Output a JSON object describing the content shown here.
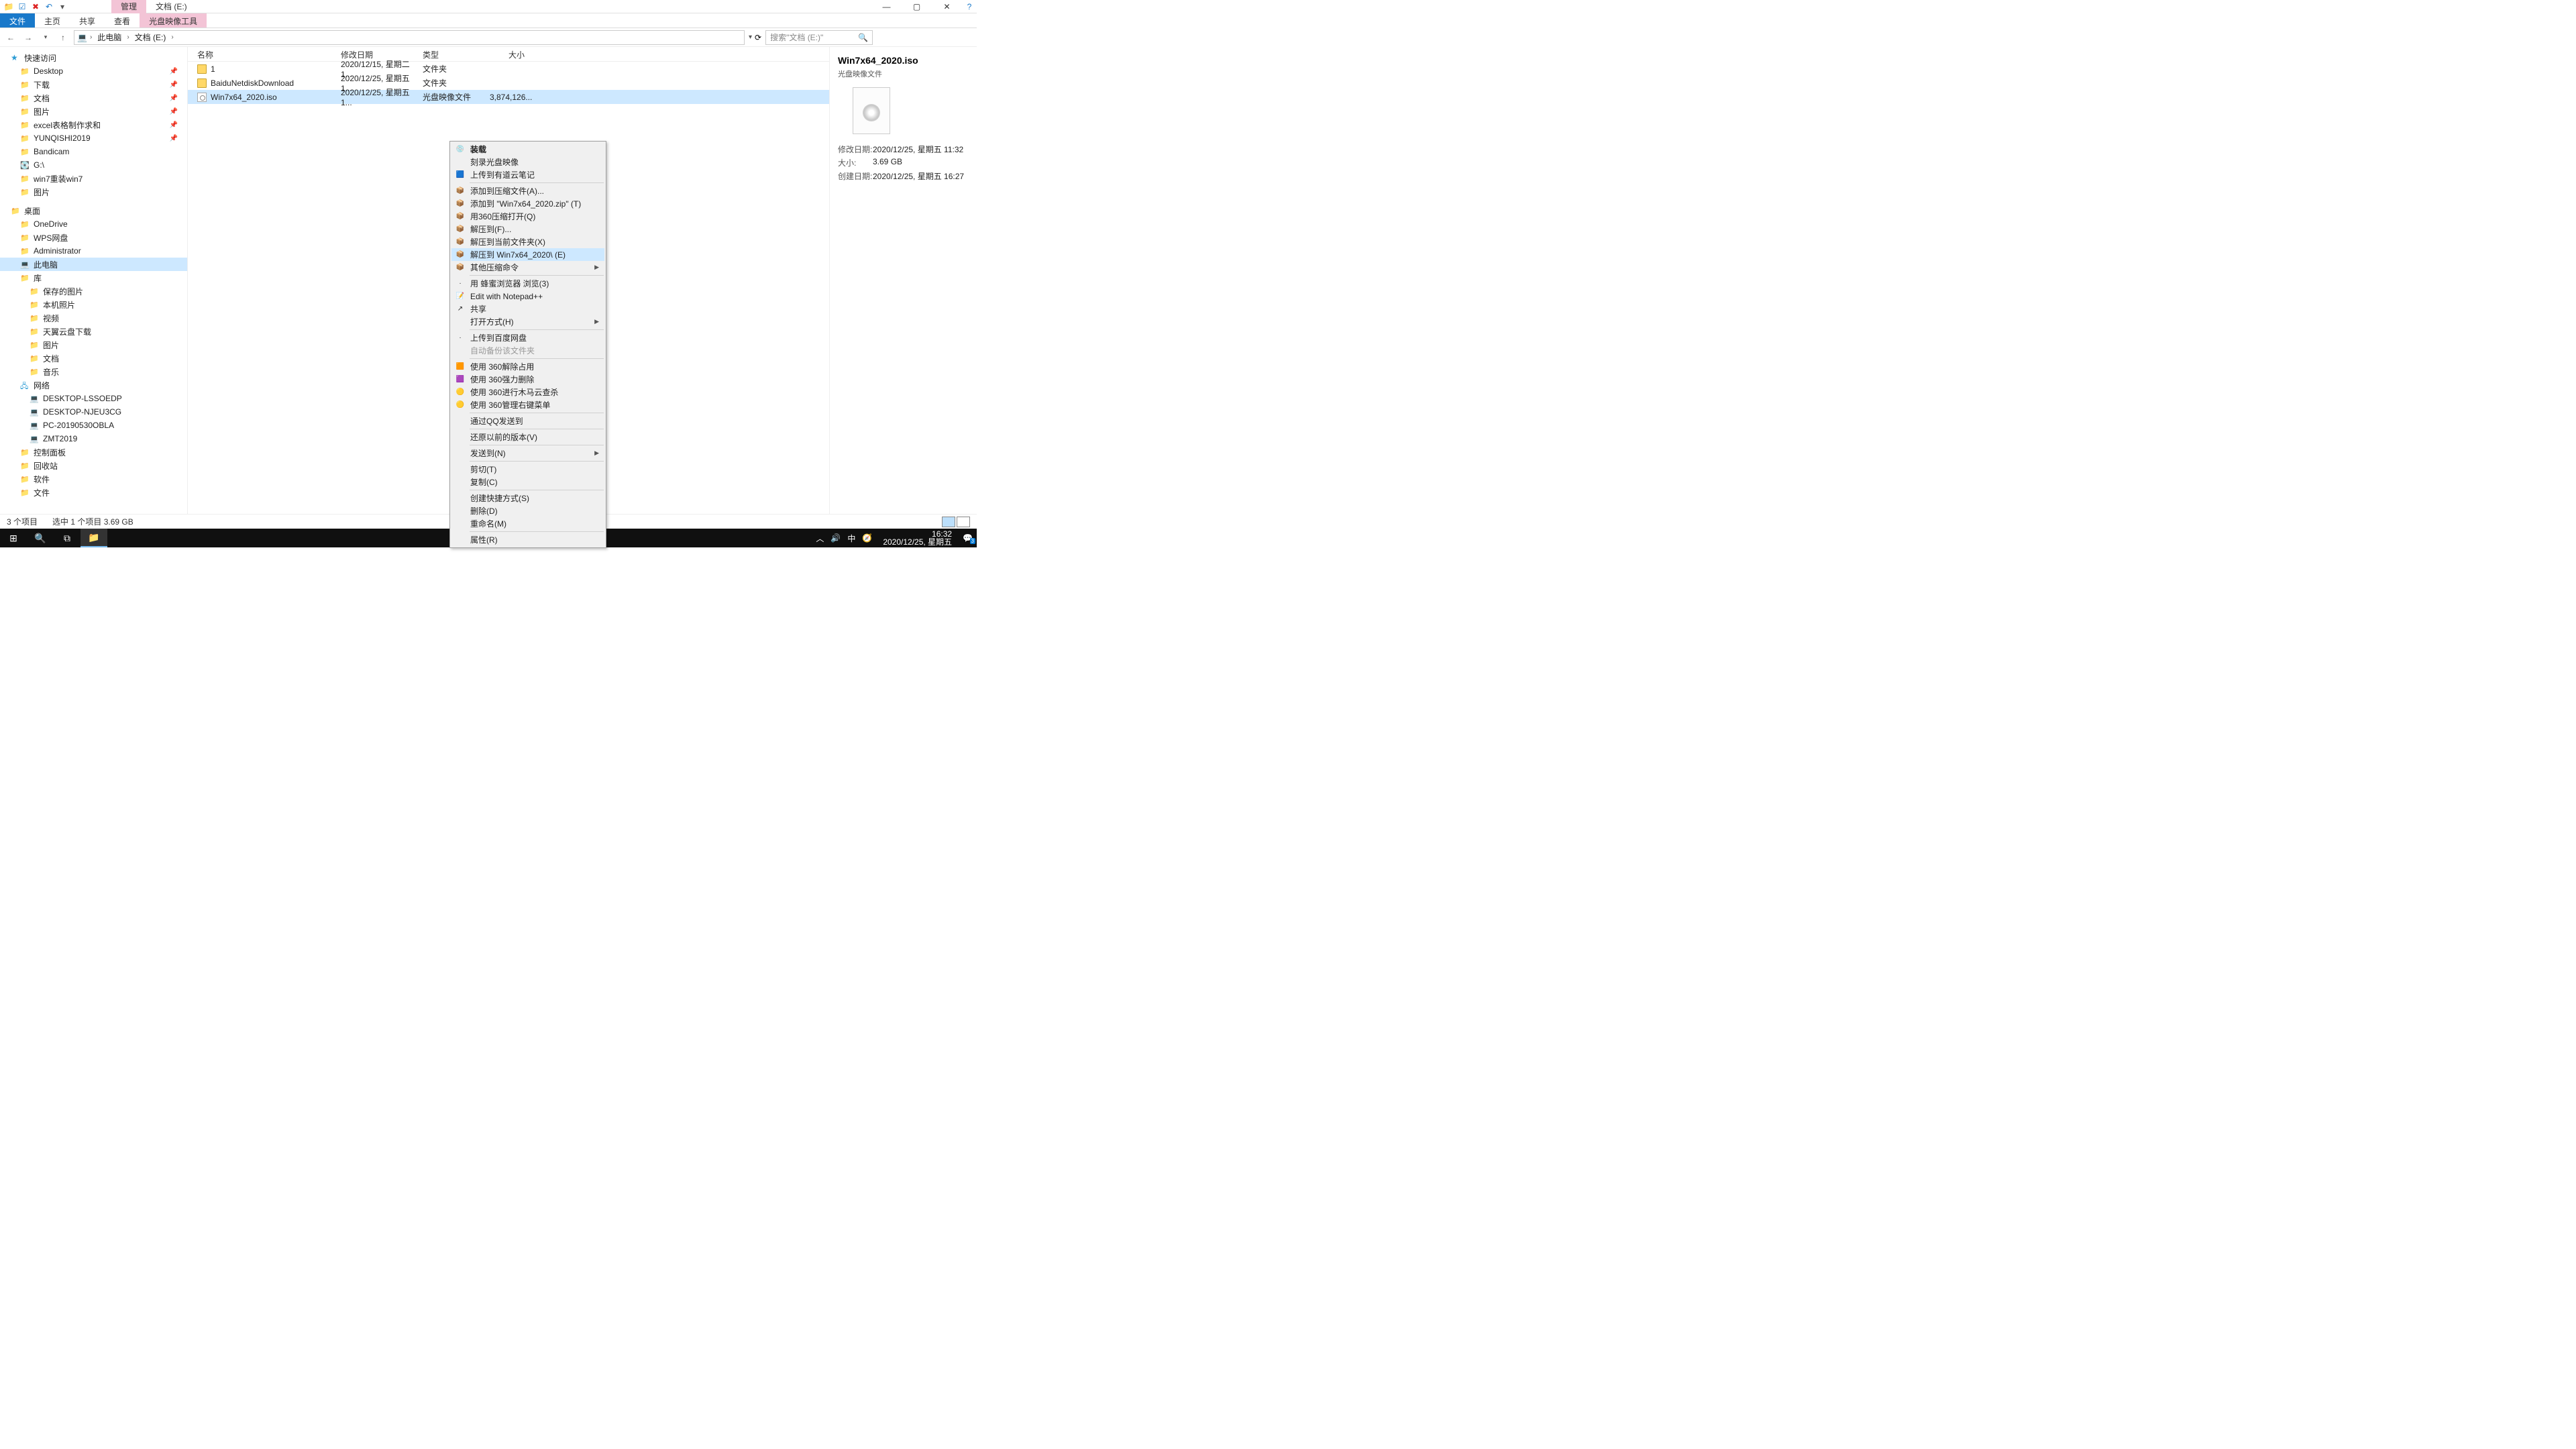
{
  "titlebar": {
    "tab_active": "管理",
    "tab_title": "文档 (E:)"
  },
  "ribbon": {
    "file": "文件",
    "home": "主页",
    "share": "共享",
    "view": "查看",
    "disc": "光盘映像工具"
  },
  "address": {
    "back": "←",
    "fwd": "→",
    "up": "↑",
    "crumbs": [
      "此电脑",
      "文档 (E:)"
    ],
    "refresh": "⟳",
    "search_placeholder": "搜索\"文档 (E:)\""
  },
  "tree": [
    {
      "label": "快速访问",
      "depth": 0,
      "icon": "star"
    },
    {
      "label": "Desktop",
      "depth": 1,
      "icon": "folder",
      "pin": true
    },
    {
      "label": "下载",
      "depth": 1,
      "icon": "folder",
      "pin": true
    },
    {
      "label": "文档",
      "depth": 1,
      "icon": "folder",
      "pin": true
    },
    {
      "label": "图片",
      "depth": 1,
      "icon": "folder",
      "pin": true
    },
    {
      "label": "excel表格制作求和",
      "depth": 1,
      "icon": "folder",
      "pin": true
    },
    {
      "label": "YUNQISHI2019",
      "depth": 1,
      "icon": "folder",
      "pin": true
    },
    {
      "label": "Bandicam",
      "depth": 1,
      "icon": "folder"
    },
    {
      "label": "G:\\",
      "depth": 1,
      "icon": "disk"
    },
    {
      "label": "win7重装win7",
      "depth": 1,
      "icon": "folder"
    },
    {
      "label": "图片",
      "depth": 1,
      "icon": "folder"
    },
    {
      "gap": true
    },
    {
      "label": "桌面",
      "depth": 0,
      "icon": "folder"
    },
    {
      "label": "OneDrive",
      "depth": 1,
      "icon": "folder"
    },
    {
      "label": "WPS网盘",
      "depth": 1,
      "icon": "folder"
    },
    {
      "label": "Administrator",
      "depth": 1,
      "icon": "folder"
    },
    {
      "label": "此电脑",
      "depth": 1,
      "icon": "pc",
      "sel": true
    },
    {
      "label": "库",
      "depth": 1,
      "icon": "folder"
    },
    {
      "label": "保存的图片",
      "depth": 2,
      "icon": "folder"
    },
    {
      "label": "本机照片",
      "depth": 2,
      "icon": "folder"
    },
    {
      "label": "视频",
      "depth": 2,
      "icon": "folder"
    },
    {
      "label": "天翼云盘下载",
      "depth": 2,
      "icon": "folder"
    },
    {
      "label": "图片",
      "depth": 2,
      "icon": "folder"
    },
    {
      "label": "文档",
      "depth": 2,
      "icon": "folder"
    },
    {
      "label": "音乐",
      "depth": 2,
      "icon": "folder"
    },
    {
      "label": "网络",
      "depth": 1,
      "icon": "net"
    },
    {
      "label": "DESKTOP-LSSOEDP",
      "depth": 2,
      "icon": "pc"
    },
    {
      "label": "DESKTOP-NJEU3CG",
      "depth": 2,
      "icon": "pc"
    },
    {
      "label": "PC-20190530OBLA",
      "depth": 2,
      "icon": "pc"
    },
    {
      "label": "ZMT2019",
      "depth": 2,
      "icon": "pc"
    },
    {
      "label": "控制面板",
      "depth": 1,
      "icon": "folder"
    },
    {
      "label": "回收站",
      "depth": 1,
      "icon": "folder"
    },
    {
      "label": "软件",
      "depth": 1,
      "icon": "folder"
    },
    {
      "label": "文件",
      "depth": 1,
      "icon": "folder"
    }
  ],
  "columns": {
    "name": "名称",
    "date": "修改日期",
    "type": "类型",
    "size": "大小"
  },
  "rows": [
    {
      "name": "1",
      "date": "2020/12/15, 星期二 1...",
      "type": "文件夹",
      "size": "",
      "icon": "folder"
    },
    {
      "name": "BaiduNetdiskDownload",
      "date": "2020/12/25, 星期五 1...",
      "type": "文件夹",
      "size": "",
      "icon": "folder"
    },
    {
      "name": "Win7x64_2020.iso",
      "date": "2020/12/25, 星期五 1...",
      "type": "光盘映像文件",
      "size": "3,874,126...",
      "icon": "iso",
      "sel": true
    }
  ],
  "context_menu": [
    {
      "label": "装载",
      "bold": true,
      "ico": "💿"
    },
    {
      "label": "刻录光盘映像"
    },
    {
      "label": "上传到有道云笔记",
      "ico": "🟦"
    },
    {
      "sep": true
    },
    {
      "label": "添加到压缩文件(A)...",
      "ico": "📦"
    },
    {
      "label": "添加到 \"Win7x64_2020.zip\" (T)",
      "ico": "📦"
    },
    {
      "label": "用360压缩打开(Q)",
      "ico": "📦"
    },
    {
      "label": "解压到(F)...",
      "ico": "📦"
    },
    {
      "label": "解压到当前文件夹(X)",
      "ico": "📦"
    },
    {
      "label": "解压到 Win7x64_2020\\ (E)",
      "ico": "📦",
      "hl": true
    },
    {
      "label": "其他压缩命令",
      "ico": "📦",
      "sub": true
    },
    {
      "sep": true
    },
    {
      "label": "用 蜂蜜浏览器 浏览(3)",
      "ico": "·"
    },
    {
      "label": "Edit with Notepad++",
      "ico": "📝"
    },
    {
      "label": "共享",
      "ico": "↗"
    },
    {
      "label": "打开方式(H)",
      "sub": true
    },
    {
      "sep": true
    },
    {
      "label": "上传到百度网盘",
      "ico": "·"
    },
    {
      "label": "自动备份该文件夹",
      "dis": true
    },
    {
      "sep": true
    },
    {
      "label": "使用 360解除占用",
      "ico": "🟧"
    },
    {
      "label": "使用 360强力删除",
      "ico": "🟪"
    },
    {
      "label": "使用 360进行木马云查杀",
      "ico": "🟡"
    },
    {
      "label": "使用 360管理右键菜单",
      "ico": "🟡"
    },
    {
      "sep": true
    },
    {
      "label": "通过QQ发送到"
    },
    {
      "sep": true
    },
    {
      "label": "还原以前的版本(V)"
    },
    {
      "sep": true
    },
    {
      "label": "发送到(N)",
      "sub": true
    },
    {
      "sep": true
    },
    {
      "label": "剪切(T)"
    },
    {
      "label": "复制(C)"
    },
    {
      "sep": true
    },
    {
      "label": "创建快捷方式(S)"
    },
    {
      "label": "删除(D)"
    },
    {
      "label": "重命名(M)"
    },
    {
      "sep": true
    },
    {
      "label": "属性(R)"
    }
  ],
  "preview": {
    "title": "Win7x64_2020.iso",
    "sub": "光盘映像文件",
    "props": [
      {
        "k": "修改日期:",
        "v": "2020/12/25, 星期五 11:32"
      },
      {
        "k": "大小:",
        "v": "3.69 GB"
      },
      {
        "k": "创建日期:",
        "v": "2020/12/25, 星期五 16:27"
      }
    ]
  },
  "status": {
    "count": "3 个项目",
    "sel": "选中 1 个项目  3.69 GB"
  },
  "taskbar": {
    "tray_ime": "中",
    "time": "16:32",
    "date": "2020/12/25, 星期五",
    "badge": "3"
  }
}
